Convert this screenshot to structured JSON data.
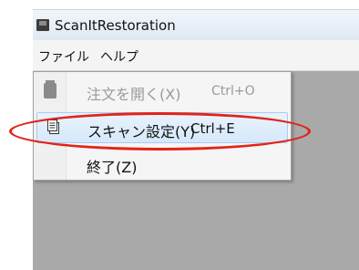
{
  "window": {
    "title": "ScanItRestoration",
    "app_icon": "app-window-icon"
  },
  "menubar": {
    "file": "ファイル",
    "help": "ヘルプ"
  },
  "file_menu": {
    "items": [
      {
        "label": "注文を開く(X)",
        "shortcut": "Ctrl+O",
        "enabled": false,
        "icon": "open-folder-icon"
      },
      {
        "label": "スキャン設定(Y)",
        "shortcut": "Ctrl+E",
        "enabled": true,
        "highlighted": true,
        "icon": "scan-settings-icon"
      },
      {
        "label": "終了(Z)",
        "shortcut": "",
        "enabled": true
      }
    ]
  },
  "annotation": {
    "color": "#e2231a",
    "shape": "ellipse highlighting scan settings item"
  }
}
